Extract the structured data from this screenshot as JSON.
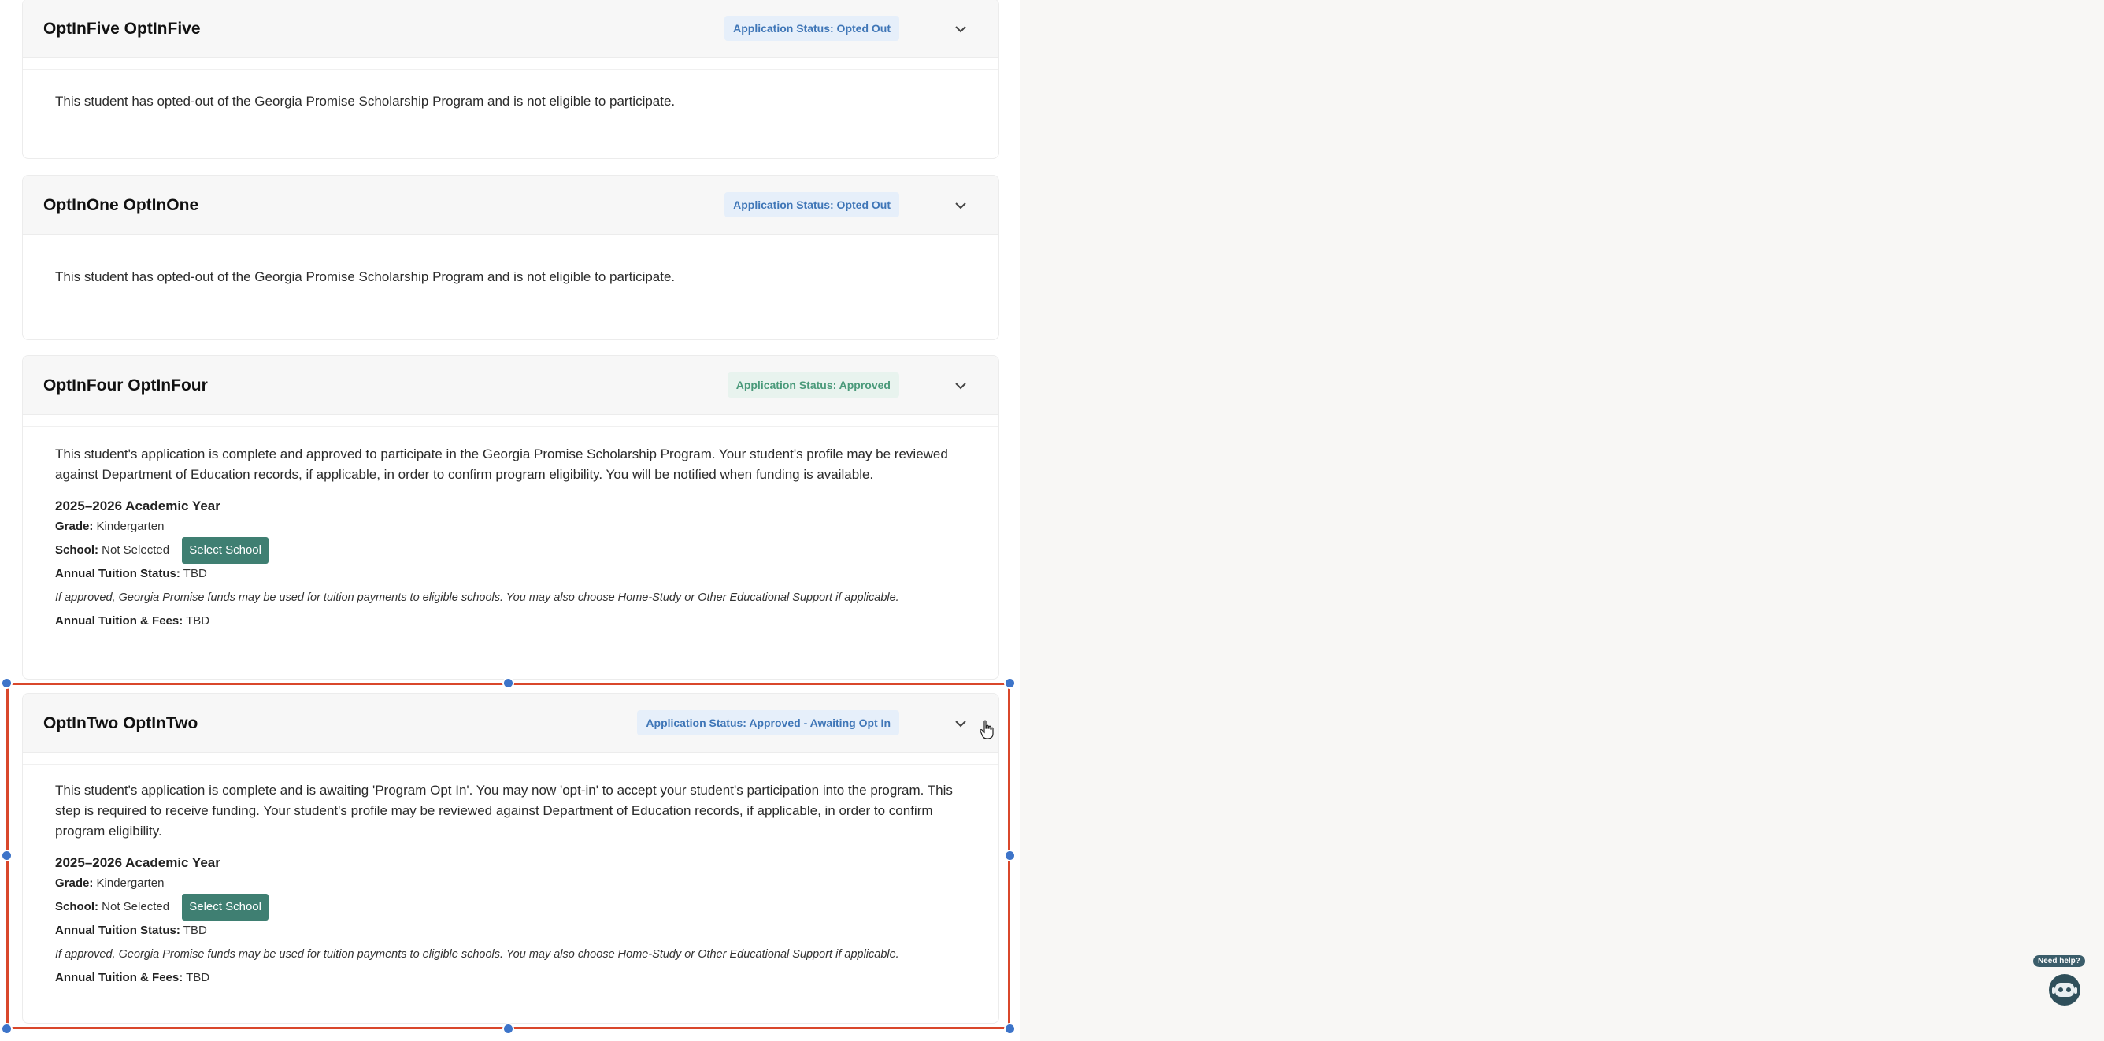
{
  "students": [
    {
      "name": "OptInFive OptInFive",
      "status": "Application Status: Opted Out",
      "message": "This student has opted-out of the Georgia Promise Scholarship Program and is not eligible to participate."
    },
    {
      "name": "OptInOne OptInOne",
      "status": "Application Status: Opted Out",
      "message": "This student has opted-out of the Georgia Promise Scholarship Program and is not eligible to participate."
    },
    {
      "name": "OptInFour OptInFour",
      "status": "Application Status: Approved",
      "message": "This student's application is complete and approved to participate in the Georgia Promise Scholarship Program. Your student's profile may be reviewed against Department of Education records, if applicable, in order to confirm program eligibility. You will be notified when funding is available.",
      "academic_year": "2025–2026 Academic Year",
      "grade_label": "Grade:",
      "grade": "Kindergarten",
      "school_label": "School:",
      "school": "Not Selected",
      "select_school_button": "Select School",
      "tuition_status_label": "Annual Tuition Status:",
      "tuition_status": "TBD",
      "note": "If approved, Georgia Promise funds may be used for tuition payments to eligible schools. You may also choose Home-Study or Other Educational Support if applicable.",
      "fees_label": "Annual Tuition & Fees:",
      "fees": "TBD"
    },
    {
      "name": "OptInTwo OptInTwo",
      "status": "Application Status: Approved - Awaiting Opt In",
      "message": "This student's application is complete and is awaiting 'Program Opt In'. You may now 'opt-in' to accept your student's participation into the program. This step is required to receive funding. Your student's profile may be reviewed against Department of Education records, if applicable, in order to confirm program eligibility.",
      "academic_year": "2025–2026 Academic Year",
      "grade_label": "Grade:",
      "grade": "Kindergarten",
      "school_label": "School:",
      "school": "Not Selected",
      "select_school_button": "Select School",
      "tuition_status_label": "Annual Tuition Status:",
      "tuition_status": "TBD",
      "note": "If approved, Georgia Promise funds may be used for tuition payments to eligible schools. You may also choose Home-Study or Other Educational Support if applicable.",
      "fees_label": "Annual Tuition & Fees:",
      "fees": "TBD"
    }
  ],
  "help_widget": {
    "label": "Need help?",
    "icon": "chatbot-icon"
  },
  "icons": {
    "expand": "chevron-down-icon",
    "cursor": "hand-pointer-icon"
  },
  "colors": {
    "status_blue_bg": "#e6effa",
    "status_blue_text": "#3f76b7",
    "status_green_bg": "#e8f3ee",
    "status_green_text": "#4a9a7a",
    "select_button": "#3f7f72",
    "selection_border": "#d9472b",
    "selection_handle": "#3d74c9"
  }
}
